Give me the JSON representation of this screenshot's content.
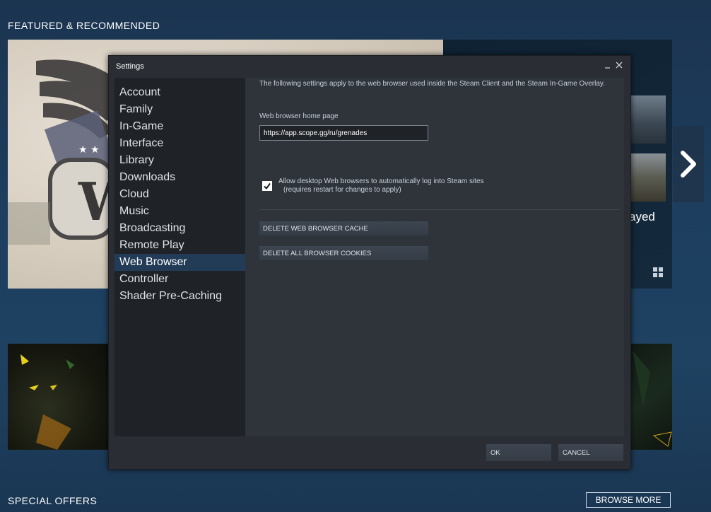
{
  "store": {
    "featured_title": "FEATURED & RECOMMENDED",
    "special_offers_title": "SPECIAL OFFERS",
    "browse_more_label": "BROWSE MORE",
    "side_text_fragment": "ayed",
    "next_arrow_icon": "chevron-right-icon",
    "platform_icon": "windows-icon"
  },
  "dialog": {
    "title": "Settings",
    "minimize_icon": "minimize-icon",
    "close_icon": "close-icon",
    "nav": [
      {
        "label": "Account"
      },
      {
        "label": "Family"
      },
      {
        "label": "In-Game"
      },
      {
        "label": "Interface"
      },
      {
        "label": "Library"
      },
      {
        "label": "Downloads"
      },
      {
        "label": "Cloud"
      },
      {
        "label": "Music"
      },
      {
        "label": "Broadcasting"
      },
      {
        "label": "Remote Play"
      },
      {
        "label": "Web Browser"
      },
      {
        "label": "Controller"
      },
      {
        "label": "Shader Pre-Caching"
      }
    ],
    "active_nav": "Web Browser",
    "content": {
      "intro": "The following settings apply to the web browser used inside the Steam Client and the Steam In-Game Overlay.",
      "home_page_label": "Web browser home page",
      "home_page_value": "https://app.scope.gg/ru/grenades",
      "auto_login_label": "Allow desktop Web browsers to automatically log into Steam sites",
      "auto_login_note": "(requires restart for changes to apply)",
      "auto_login_checked": true,
      "delete_cache_label": "DELETE WEB BROWSER CACHE",
      "delete_cookies_label": "DELETE ALL BROWSER COOKIES"
    },
    "ok_label": "OK",
    "cancel_label": "CANCEL"
  },
  "colors": {
    "page_bg": "#1b3450",
    "dialog_bg": "#2a2e34",
    "sidebar_bg": "#1f2227",
    "content_bg": "#2f343b",
    "active_item": "#223b56",
    "button_bg": "#3d4550"
  }
}
